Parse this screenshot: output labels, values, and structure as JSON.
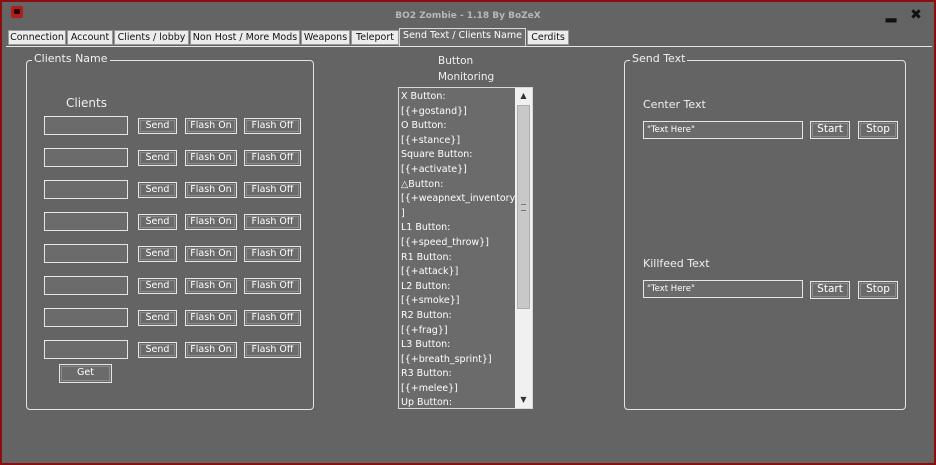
{
  "window": {
    "title": "BO2 Zombie - 1.18 By BoZeX",
    "minimize_label": "▂",
    "close_label": "✖"
  },
  "tabs": [
    {
      "label": "Connection"
    },
    {
      "label": "Account"
    },
    {
      "label": "Clients / lobby"
    },
    {
      "label": "Non Host / More Mods"
    },
    {
      "label": "Weapons"
    },
    {
      "label": "Teleport"
    },
    {
      "label": "Send Text  / Clients Name"
    },
    {
      "label": "Cerdits"
    }
  ],
  "clients_panel": {
    "title": "Clients Name",
    "heading": "Clients",
    "rows": [
      {
        "value": "",
        "send": "Send",
        "flash_on": "Flash On",
        "flash_off": "Flash Off"
      },
      {
        "value": "",
        "send": "Send",
        "flash_on": "Flash On",
        "flash_off": "Flash Off"
      },
      {
        "value": "",
        "send": "Send",
        "flash_on": "Flash On",
        "flash_off": "Flash Off"
      },
      {
        "value": "",
        "send": "Send",
        "flash_on": "Flash On",
        "flash_off": "Flash Off"
      },
      {
        "value": "",
        "send": "Send",
        "flash_on": "Flash On",
        "flash_off": "Flash Off"
      },
      {
        "value": "",
        "send": "Send",
        "flash_on": "Flash On",
        "flash_off": "Flash Off"
      },
      {
        "value": "",
        "send": "Send",
        "flash_on": "Flash On",
        "flash_off": "Flash Off"
      },
      {
        "value": "",
        "send": "Send",
        "flash_on": "Flash On",
        "flash_off": "Flash Off"
      }
    ],
    "get_label": "Get"
  },
  "monitoring": {
    "title_line1": "Button",
    "title_line2": "Monitoring",
    "lines": [
      "X Button:",
      "[{+gostand}]",
      "O Button:",
      "[{+stance}]",
      "Square  Button:",
      "[{+activate}]",
      "△Button:",
      "[{+weapnext_inventory}",
      "]",
      "L1 Button:",
      "[{+speed_throw}]",
      "R1 Button:",
      "[{+attack}]",
      "L2 Button:",
      "[{+smoke}]",
      "R2 Button:",
      "[{+frag}]",
      "L3 Button:",
      "[{+breath_sprint}]",
      "R3 Button:",
      "[{+melee}]",
      "Up Button:"
    ],
    "scroll_up": "▲",
    "scroll_down": "▼"
  },
  "send_text_panel": {
    "title": "Send Text",
    "center": {
      "label": "Center Text",
      "value": "\"Text Here\"",
      "start": "Start",
      "stop": "Stop"
    },
    "killfeed": {
      "label": "Killfeed Text",
      "value": "\"Text Here\"",
      "start": "Start",
      "stop": "Stop"
    }
  }
}
